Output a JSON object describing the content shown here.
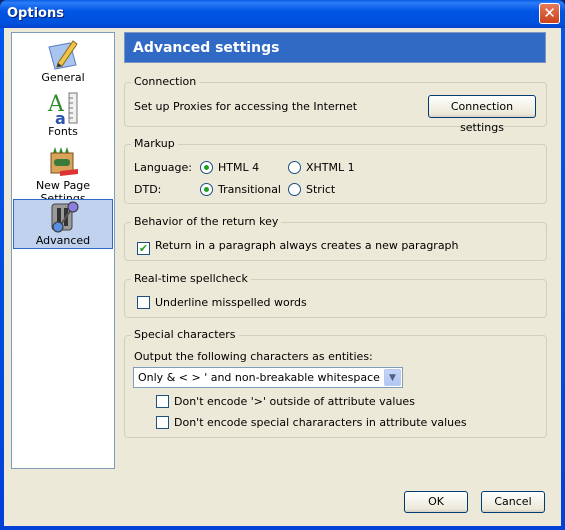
{
  "window": {
    "title": "Options",
    "close_glyph": "✕"
  },
  "sidebar": {
    "items": [
      {
        "label": "General",
        "icon": "pencil-paper-icon",
        "selected": false
      },
      {
        "label": "Fonts",
        "icon": "font-ruler-icon",
        "selected": false
      },
      {
        "label": "New Page Settings",
        "icon": "crayon-box-icon",
        "selected": false
      },
      {
        "label": "Advanced",
        "icon": "advanced-switch-icon",
        "selected": true
      }
    ]
  },
  "panel": {
    "header": "Advanced settings",
    "connection": {
      "legend": "Connection",
      "text": "Set up Proxies for accessing the Internet",
      "button": "Connection settings"
    },
    "markup": {
      "legend": "Markup",
      "language_label": "Language:",
      "language_options": [
        "HTML 4",
        "XHTML 1"
      ],
      "language_selected": "HTML 4",
      "dtd_label": "DTD:",
      "dtd_options": [
        "Transitional",
        "Strict"
      ],
      "dtd_selected": "Transitional"
    },
    "return_key": {
      "legend": "Behavior of the return key",
      "checkbox": "Return in a paragraph always creates a new paragraph",
      "checked": true
    },
    "spellcheck": {
      "legend": "Real-time spellcheck",
      "checkbox": "Underline misspelled words",
      "checked": false
    },
    "special": {
      "legend": "Special characters",
      "label": "Output the following characters as entities:",
      "select_value": "Only & < > ' and non-breakable whitespace",
      "cb1": "Don't encode '>' outside of attribute values",
      "cb1_checked": false,
      "cb2": "Don't encode special chararacters in attribute values",
      "cb2_checked": false
    }
  },
  "buttons": {
    "ok": "OK",
    "cancel": "Cancel"
  },
  "colors": {
    "titlebar": "#0055e3",
    "header": "#316ac5",
    "selection": "#c1d2ee",
    "face": "#ece9d8"
  }
}
